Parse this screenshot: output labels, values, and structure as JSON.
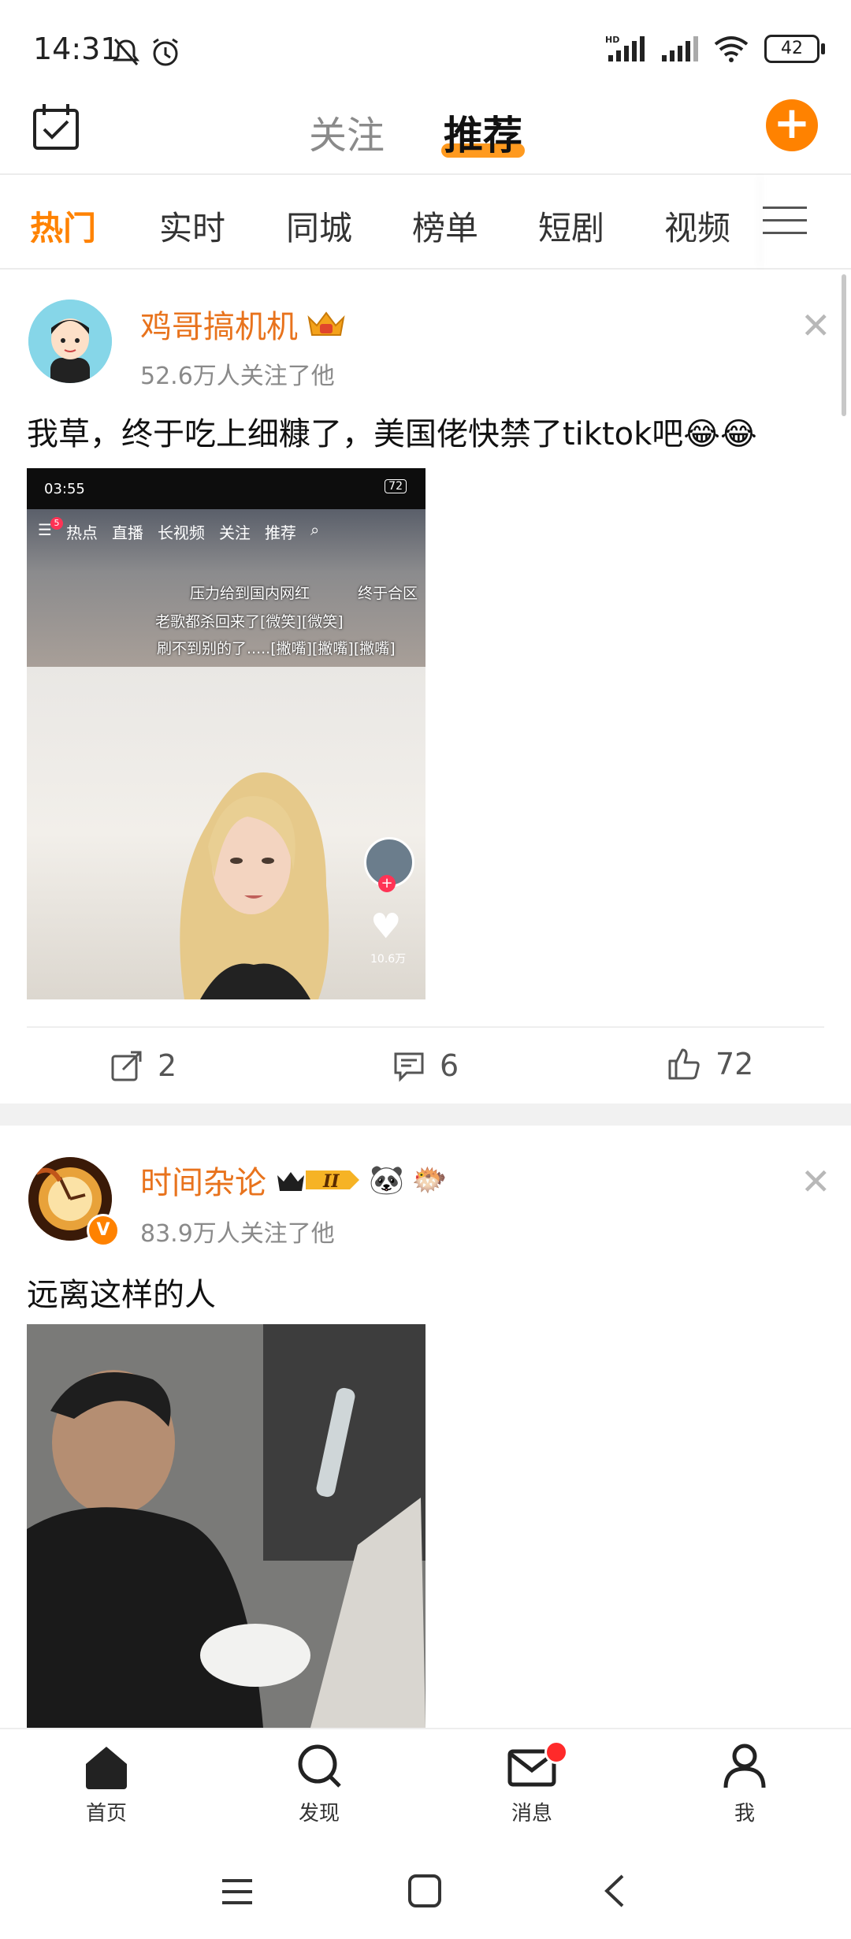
{
  "status": {
    "time": "14:31",
    "battery": "42"
  },
  "topnav": {
    "follow_tab": "关注",
    "recommend_tab": "推荐"
  },
  "categories": [
    "热门",
    "实时",
    "同城",
    "榜单",
    "短剧",
    "视频"
  ],
  "posts": [
    {
      "author": "鸡哥搞机机",
      "followers": "52.6万人关注了他",
      "text": "我草，终于吃上细糠了，美国佬快禁了tiktok吧😂😂",
      "media": {
        "time": "03:55",
        "tabs": [
          "热点",
          "直播",
          "长视频",
          "关注",
          "推荐"
        ],
        "badge": "5",
        "danmaku": [
          "压力给到国内网红",
          "终于合区",
          "老歌都杀回来了[微笑][微笑]",
          "刷不到别的了.....[撇嘴][撇嘴][撇嘴]"
        ],
        "likes": "10.6万"
      },
      "reposts": "2",
      "comments": "6",
      "likes": "72"
    },
    {
      "author": "时间杂论",
      "followers": "83.9万人关注了他",
      "text": "远离这样的人"
    }
  ],
  "bottom_nav": [
    "首页",
    "发现",
    "消息",
    "我"
  ],
  "colors": {
    "accent": "#ff8200",
    "name": "#e8731d"
  }
}
